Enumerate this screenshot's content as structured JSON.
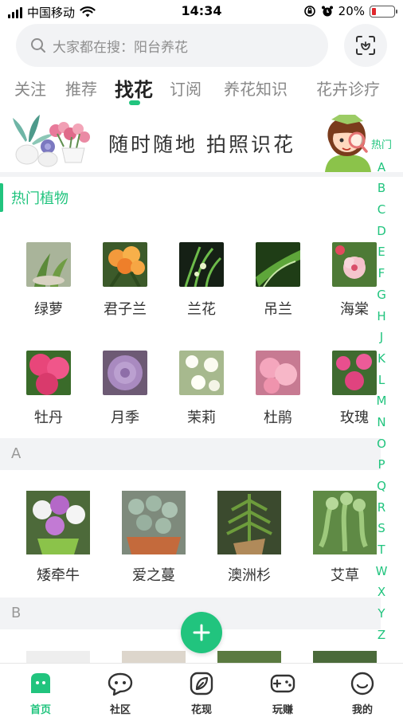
{
  "status_bar": {
    "carrier": "中国移动",
    "time": "14:34",
    "battery": "20%",
    "battery_level": 0.2
  },
  "search": {
    "placeholder": "大家都在搜：阳台养花"
  },
  "tabs": [
    {
      "label": "关注"
    },
    {
      "label": "推荐"
    },
    {
      "label": "找花",
      "active": true
    },
    {
      "label": "订阅"
    },
    {
      "label": "养花知识"
    },
    {
      "label": "花卉诊疗"
    }
  ],
  "banner": {
    "text": "随时随地 拍照识花"
  },
  "hot_section": {
    "title": "热门植物",
    "plants": [
      {
        "name": "绿萝"
      },
      {
        "name": "君子兰"
      },
      {
        "name": "兰花"
      },
      {
        "name": "吊兰"
      },
      {
        "name": "海棠"
      },
      {
        "name": "牡丹"
      },
      {
        "name": "月季"
      },
      {
        "name": "茉莉"
      },
      {
        "name": "杜鹃"
      },
      {
        "name": "玫瑰"
      }
    ]
  },
  "section_a": {
    "letter": "A",
    "plants": [
      {
        "name": "矮牵牛"
      },
      {
        "name": "爱之蔓"
      },
      {
        "name": "澳洲杉"
      },
      {
        "name": "艾草"
      }
    ]
  },
  "section_b": {
    "letter": "B"
  },
  "index_bar": [
    "热门",
    "A",
    "B",
    "C",
    "D",
    "E",
    "F",
    "G",
    "H",
    "J",
    "K",
    "L",
    "M",
    "N",
    "O",
    "P",
    "Q",
    "R",
    "S",
    "T",
    "W",
    "X",
    "Y",
    "Z"
  ],
  "bottom_nav": [
    {
      "label": "首页",
      "icon": "home-icon",
      "active": true
    },
    {
      "label": "社区",
      "icon": "chat-icon"
    },
    {
      "label": "花现",
      "icon": "leaf-icon"
    },
    {
      "label": "玩赚",
      "icon": "gamepad-icon"
    },
    {
      "label": "我的",
      "icon": "smile-icon"
    }
  ],
  "colors": {
    "accent": "#21c47e",
    "battery_low": "#e0282d"
  }
}
